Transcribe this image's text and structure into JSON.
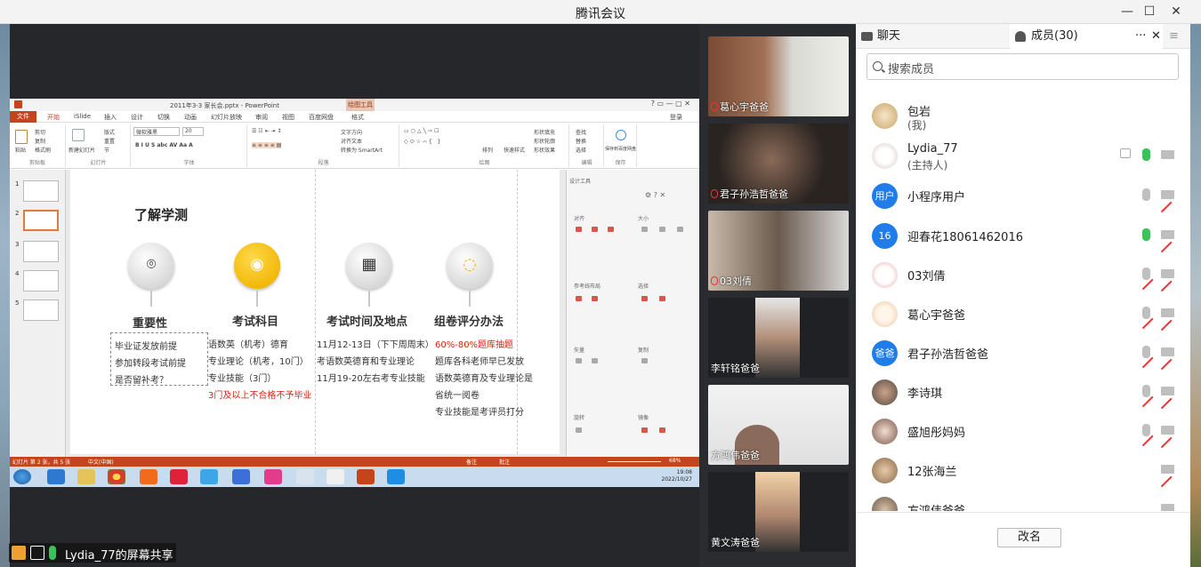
{
  "window": {
    "title": "腾讯会议",
    "min": "—",
    "max": "☐",
    "close": "✕"
  },
  "ppt": {
    "doc_title": "2011年3-3 家长会.pptx - PowerPoint",
    "context_tab": "绘图工具",
    "tabs": [
      "文件",
      "开始",
      "iSlide",
      "插入",
      "设计",
      "切换",
      "动画",
      "幻灯片放映",
      "审阅",
      "视图",
      "百度网盘",
      "格式"
    ],
    "user": "登录",
    "ribbon": {
      "clipboard": "剪贴板",
      "slides": "幻灯片",
      "font": "字体",
      "paragraph": "段落",
      "drawing": "绘图",
      "editing": "编辑",
      "save": "保存",
      "paste": "粘贴",
      "cut": "剪切",
      "copy": "复制",
      "format_painter": "格式刷",
      "new_slide": "新建幻灯片",
      "layout": "版式",
      "reset": "重置",
      "section": "节",
      "font_name": "微软雅黑",
      "font_size": "20",
      "text_dir": "文字方向",
      "align_text": "对齐文本",
      "smartart": "转换为 SmartArt",
      "arrange": "排列",
      "quick_styles": "快速样式",
      "fill": "形状填充",
      "outline": "形状轮廓",
      "effects": "形状效果",
      "find": "查找",
      "replace": "替换",
      "select": "选择",
      "save_net": "保存到百度网盘"
    },
    "slide_numbers": [
      "1",
      "2",
      "3",
      "4",
      "5"
    ],
    "slide": {
      "heading": "了解学测",
      "columns": [
        {
          "title": "重要性",
          "lines": [
            "毕业证发放前提",
            "参加转段考试前提",
            "是否留补考？"
          ]
        },
        {
          "title": "考试科目",
          "lines": [
            "语数英（机考）德育",
            "专业理论（机考，10门）",
            "专业技能（3门）"
          ],
          "red_line": "3门及以上不合格不予毕业"
        },
        {
          "title": "考试时间及地点",
          "lines": [
            "11月12-13日（下下周周末）",
            "考语数英德育和专业理论",
            "11月19-20左右考专业技能"
          ]
        },
        {
          "title": "组卷评分办法",
          "red_line": "60%-80%题库抽题",
          "lines": [
            "题库各科老师早已发放",
            "语数英德育及专业理论是",
            "省统一阅卷",
            "专业技能是考评员打分"
          ]
        }
      ]
    },
    "taskpane": {
      "title": "设计工具",
      "align": "对齐",
      "size": "大小",
      "ref_layout": "参考线布局",
      "select": "选择",
      "shape": "矢量",
      "copy": "复制",
      "rotate": "旋转",
      "mirror": "镜像"
    },
    "status": {
      "slide": "幻灯片 第 2 张，共 5 张",
      "lang": "中文(中国)",
      "notes": "备注",
      "comments": "批注",
      "zoom": "68%"
    },
    "clock": {
      "time": "19:08",
      "date": "2022/10/27"
    }
  },
  "share_indicator": "Lydia_77的屏幕共享",
  "videos": [
    {
      "name": "葛心宇爸爸",
      "muted": true
    },
    {
      "name": "君子孙浩哲爸爸",
      "muted": true
    },
    {
      "name": "03刘倩",
      "muted": true
    },
    {
      "name": "李轩铭爸爸",
      "muted": false
    },
    {
      "name": "方鸿伟爸爸",
      "muted": false
    },
    {
      "name": "黄文涛爸爸",
      "muted": false
    }
  ],
  "panel": {
    "tab_chat": "聊天",
    "tab_members": "成员(30)",
    "more": "···",
    "close": "✕",
    "menu": "≡",
    "search_placeholder": "搜索成员",
    "rename": "改名",
    "members": [
      {
        "name": "包岩",
        "sub": "(我)",
        "avatar": "",
        "mic": "none",
        "cam": "none"
      },
      {
        "name": "Lydia_77",
        "sub": "(主持人)",
        "avatar": "",
        "mic": "on",
        "cam": "off"
      },
      {
        "name": "小程序用户",
        "sub": "",
        "avatar": "用户",
        "mic": "off-gray",
        "cam": "muted"
      },
      {
        "name": "迎春花18061462016",
        "sub": "",
        "avatar": "16",
        "mic": "on",
        "cam": "muted"
      },
      {
        "name": "03刘倩",
        "sub": "",
        "avatar": "",
        "mic": "muted",
        "cam": "muted"
      },
      {
        "name": "葛心宇爸爸",
        "sub": "",
        "avatar": "",
        "mic": "muted",
        "cam": "muted"
      },
      {
        "name": "君子孙浩哲爸爸",
        "sub": "",
        "avatar": "爸爸",
        "mic": "muted",
        "cam": "muted"
      },
      {
        "name": "李诗琪",
        "sub": "",
        "avatar": "",
        "mic": "muted",
        "cam": "muted"
      },
      {
        "name": "盛旭彤妈妈",
        "sub": "",
        "avatar": "",
        "mic": "muted",
        "cam": "muted"
      },
      {
        "name": "12张海兰",
        "sub": "",
        "avatar": "",
        "mic": "none",
        "cam": "muted"
      },
      {
        "name": "方鸿伟爸爸",
        "sub": "",
        "avatar": "",
        "mic": "none",
        "cam": "muted"
      }
    ]
  }
}
